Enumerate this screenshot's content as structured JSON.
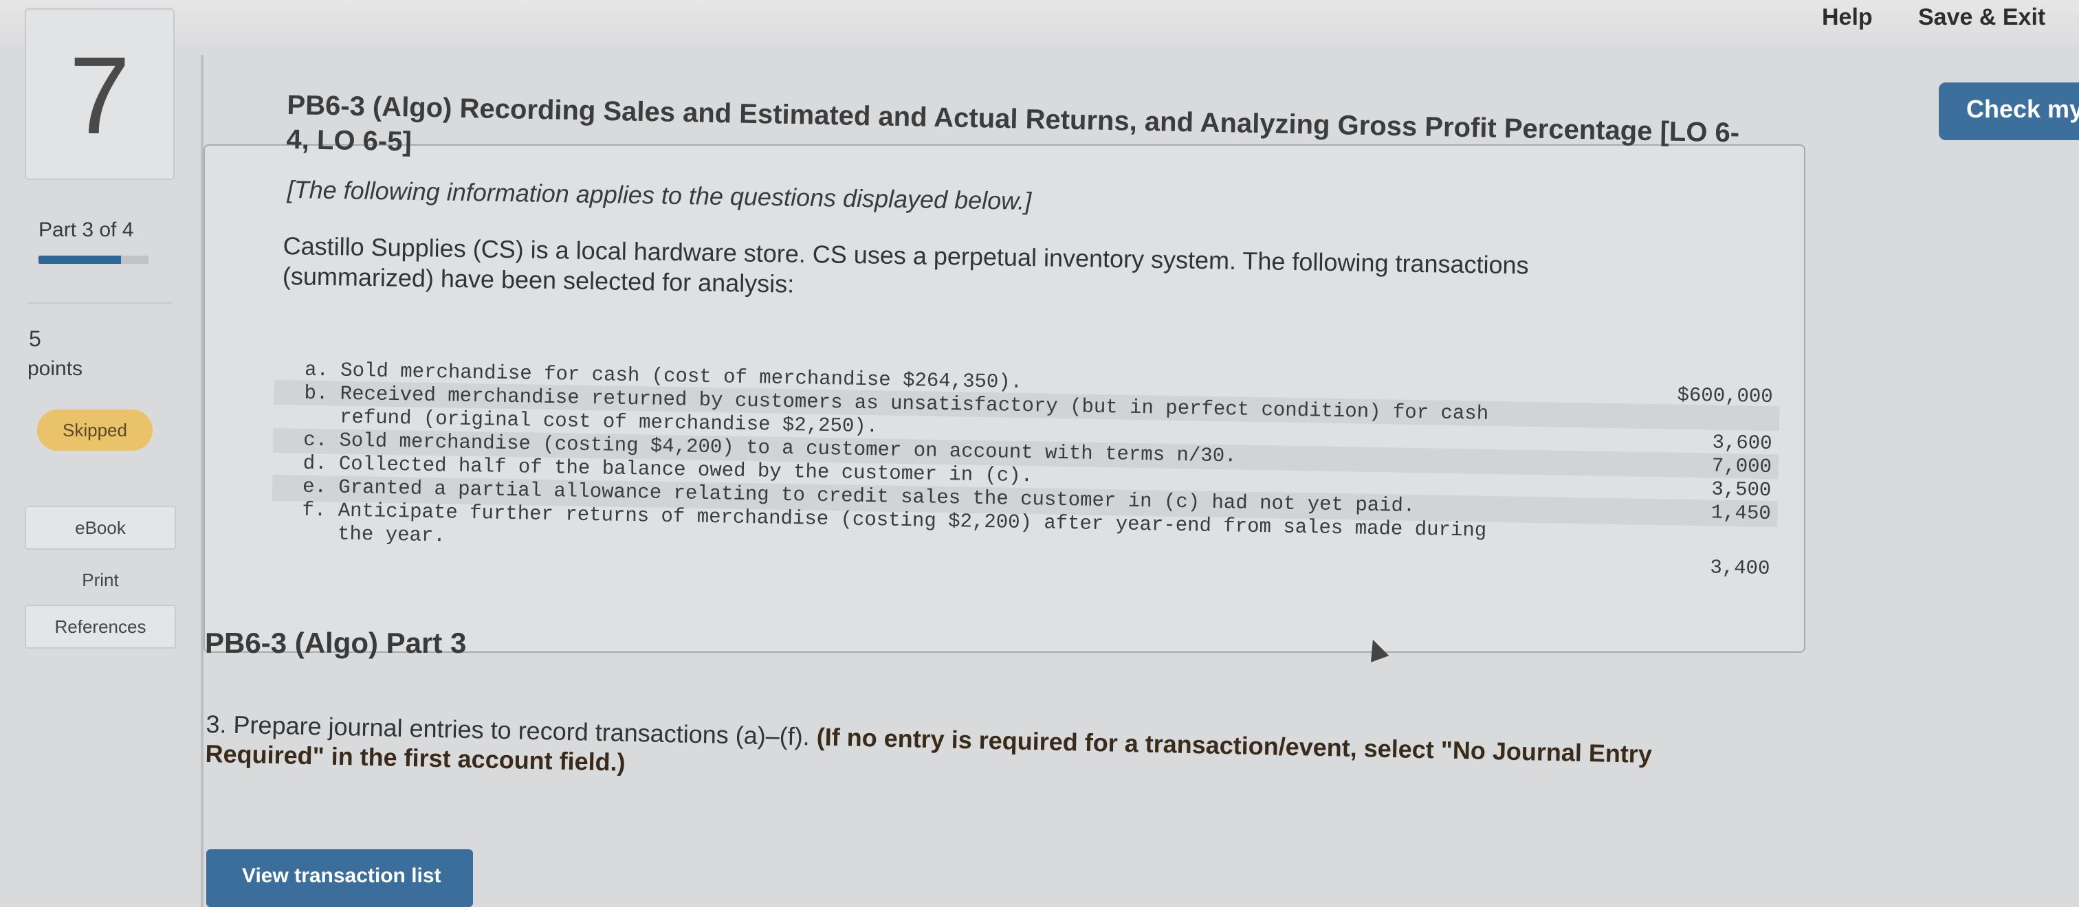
{
  "top_bar": {
    "help": "Help",
    "save_exit": "Save & Exit",
    "check_my": "Check my"
  },
  "sidebar": {
    "question_number": "7",
    "part": "Part 3 of 4",
    "part_progress_fraction": 0.75,
    "points_value": "5",
    "points_label": "points",
    "status": "Skipped",
    "links": [
      "eBook",
      "Print",
      "References"
    ]
  },
  "problem": {
    "title": "PB6-3 (Algo) Recording Sales and Estimated and Actual Returns, and Analyzing Gross Profit Percentage [LO 6-4, LO 6-5]",
    "intro": "[The following information applies to the questions displayed below.]",
    "description": "Castillo Supplies (CS) is a local hardware store. CS uses a perpetual inventory system. The following transactions (summarized) have been selected for analysis:",
    "transactions": [
      {
        "text": "a. Sold merchandise for cash (cost of merchandise $264,350).",
        "amount": "$600,000"
      },
      {
        "text": "b. Received merchandise returned by customers as unsatisfactory (but in perfect condition) for cash\n   refund (original cost of merchandise $2,250).",
        "amount": "3,600"
      },
      {
        "text": "c. Sold merchandise (costing $4,200) to a customer on account with terms n/30.",
        "amount": "7,000"
      },
      {
        "text": "d. Collected half of the balance owed by the customer in (c).",
        "amount": "3,500"
      },
      {
        "text": "e. Granted a partial allowance relating to credit sales the customer in (c) had not yet paid.",
        "amount": "1,450"
      },
      {
        "text": "f. Anticipate further returns of merchandise (costing $2,200) after year-end from sales made during\n   the year.",
        "amount": "3,400"
      }
    ]
  },
  "part3": {
    "heading": "PB6-3 (Algo) Part 3",
    "instruction_prefix": "3. Prepare journal entries to record transactions (a)–(f). ",
    "instruction_bold": "(If no entry is required for a transaction/event, select \"No Journal Entry Required\" in the first account field.)",
    "view_button": "View transaction list"
  }
}
